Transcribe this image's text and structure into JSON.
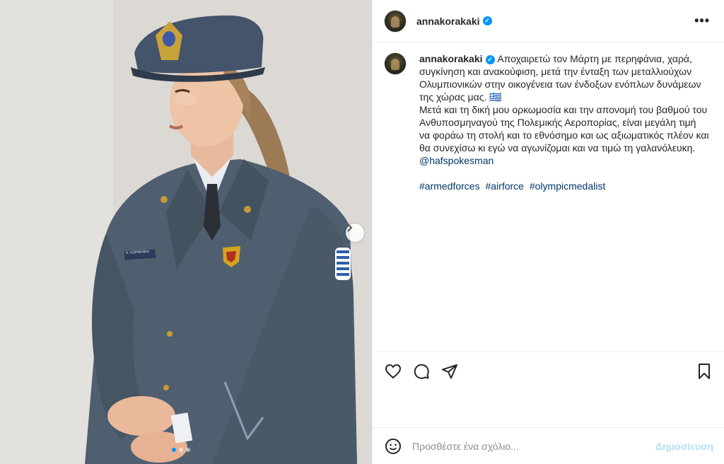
{
  "post": {
    "username": "annakorakaki",
    "more_label": "•••",
    "caption": "Αποχαιρετώ τον Μάρτη με περηφάνια, χαρά, συγκίνηση και ανακούφιση, μετά την ένταξη των μεταλλιούχων Ολυμπιονικών στην οικογένεια των ένδοξων ενόπλων δυνάμεων της χώρας μας. 🇬🇷\nΜετά και τη δική μου ορκωμοσία και την απονομή του βαθμού του Ανθυποσμηναγού της Πολεμικής Αεροπορίας, είναι μεγάλη τιμή να φοράω τη στολή και το εθνόσημο και ως αξιωματικός πλέον και θα συνεχίσω κι εγώ να αγωνίζομαι και να τιμώ τη γαλανόλευκη.",
    "mention": "@hafspokesman",
    "hashtags": [
      "#armedforces",
      "#airforce",
      "#olympicmedalist"
    ]
  },
  "media": {
    "name_tag": "A. ΚΟΡΑΚΑΚΗ",
    "carousel_index": 0,
    "carousel_count": 3
  },
  "actions": {
    "icons": [
      "heart-icon",
      "comment-icon",
      "share-icon",
      "save-icon"
    ]
  },
  "comment_box": {
    "placeholder": "Προσθέστε ένα σχόλιο...",
    "post_label": "Δημοσίευση"
  },
  "colors": {
    "verified": "#0095f6",
    "link": "#00376b",
    "post_button": "#b2dffc"
  }
}
